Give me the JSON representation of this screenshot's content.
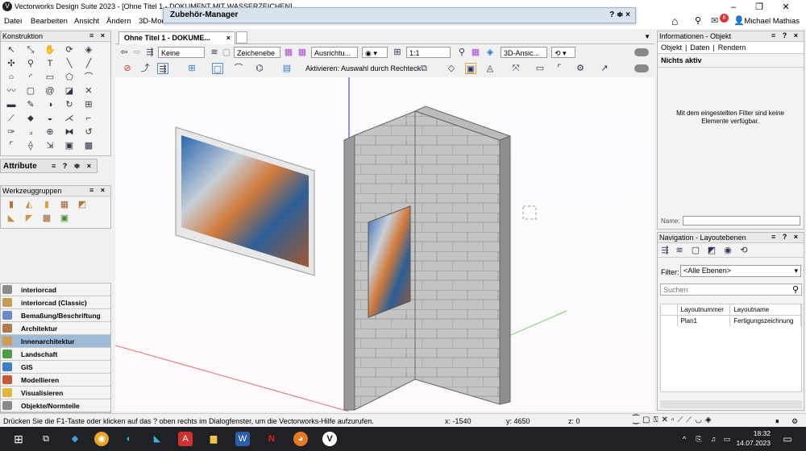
{
  "window": {
    "title": "Vectorworks Design Suite 2023 - [Ohne Titel 1 - DOKUMENT MIT WASSERZEICHEN]",
    "user": "Michael Mathias",
    "notif_count": "6"
  },
  "menu": [
    "Datei",
    "Bearbeiten",
    "Ansicht",
    "Ändern",
    "3D-Mode"
  ],
  "dialog": {
    "title": "Zubehör-Manager",
    "controls": "? ≑ ×"
  },
  "left": {
    "construction_title": "Konstruktion",
    "attributes_title": "Attribute",
    "toolgroups_title": "Werkzeuggruppen",
    "categories": [
      {
        "label": "interiorcad",
        "color": "#8b8b8b"
      },
      {
        "label": "interiorcad (Classic)",
        "color": "#c79c55"
      },
      {
        "label": "Bemaßung/Beschriftung",
        "color": "#6a8acb"
      },
      {
        "label": "Architektur",
        "color": "#b07a4a"
      },
      {
        "label": "Innenarchitektur",
        "color": "#d09a50"
      },
      {
        "label": "Landschaft",
        "color": "#4f9a44"
      },
      {
        "label": "GIS",
        "color": "#3d7fc6"
      },
      {
        "label": "Modellieren",
        "color": "#c55a3b"
      },
      {
        "label": "Visualisieren",
        "color": "#e1b73a"
      },
      {
        "label": "Objekte/Normteile",
        "color": "#8a8a8a"
      }
    ],
    "selected_category": "Innenarchitektur"
  },
  "doc_tab": "Ohne Titel 1 - DOKUME...",
  "toolbar": {
    "class_value": "Keine",
    "layer_value": "Zeichenebe",
    "align_value": "Ausrichtu...",
    "scale_value": "1:1",
    "view_value": "3D-Ansic...",
    "activate_label": "Aktivieren: Auswahl durch Rechteck"
  },
  "info": {
    "title": "Informationen - Objekt",
    "tabs": [
      "Objekt",
      "Daten",
      "Rendern"
    ],
    "nothing_active": "Nichts aktiv",
    "empty_msg": "Mit dem eingestellten Filter sind keine Elemente verfügbar.",
    "name_label": "Name:"
  },
  "nav": {
    "title": "Navigation - Layoutebenen",
    "filter_label": "Filter:",
    "filter_value": "<Alle Ebenen>",
    "search_placeholder": "Suchen",
    "col_num": "Layoutnummer",
    "col_name": "Layoutname",
    "rows": [
      {
        "num": "Plan1",
        "name": "Fertigungszeichnung"
      }
    ]
  },
  "status": {
    "hint": "Drücken Sie die F1-Taste oder klicken auf das ? oben rechts im Dialogfenster, um die Vectorworks-Hilfe aufzurufen.",
    "x": "x: -1540",
    "y": "y: 4650",
    "z": "z: 0"
  },
  "clock": {
    "time": "18:32",
    "date": "14.07.2023"
  }
}
